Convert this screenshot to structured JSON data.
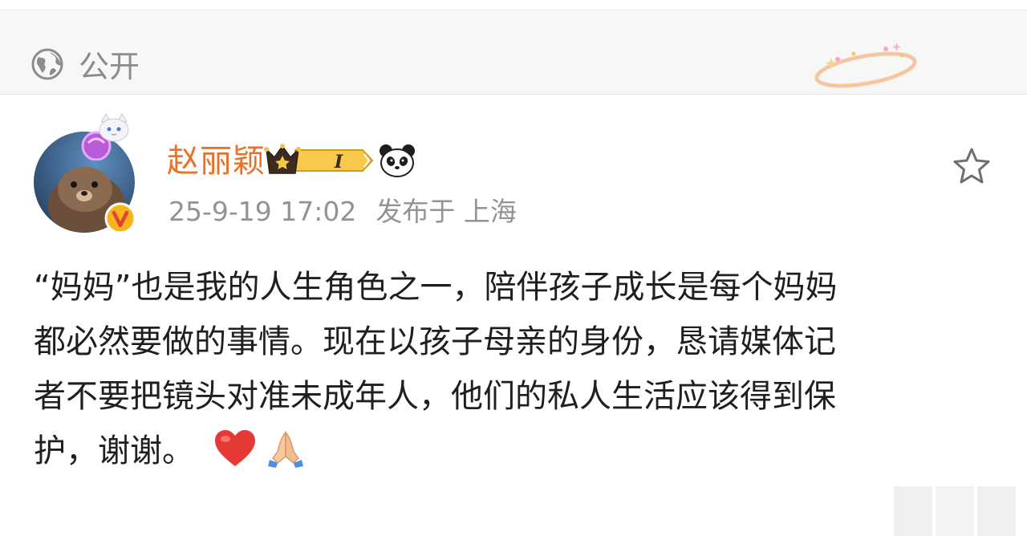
{
  "visibility": {
    "icon": "globe-icon",
    "label": "公开"
  },
  "author": {
    "name": "赵丽颖",
    "name_color": "#e8722a",
    "level_badge": "I",
    "verified_icon": "verified-v-icon",
    "extra_icon": "panda-icon"
  },
  "meta": {
    "time": "25-9-19 17:02",
    "location": "发布于 上海"
  },
  "post": {
    "lines": [
      "“妈妈”也是我的人生角色之一，陪伴孩子成长是每个妈妈",
      "都必然要做的事情。现在以孩子母亲的身份，恳请媒体记",
      "者不要把镜头对准未成年人，他们的私人生活应该得到保",
      "护，谢谢。"
    ],
    "trailing_emoji": [
      "heart-emoji",
      "praying-hands-emoji"
    ]
  },
  "actions": {
    "favorite_icon": "star-outline-icon"
  }
}
